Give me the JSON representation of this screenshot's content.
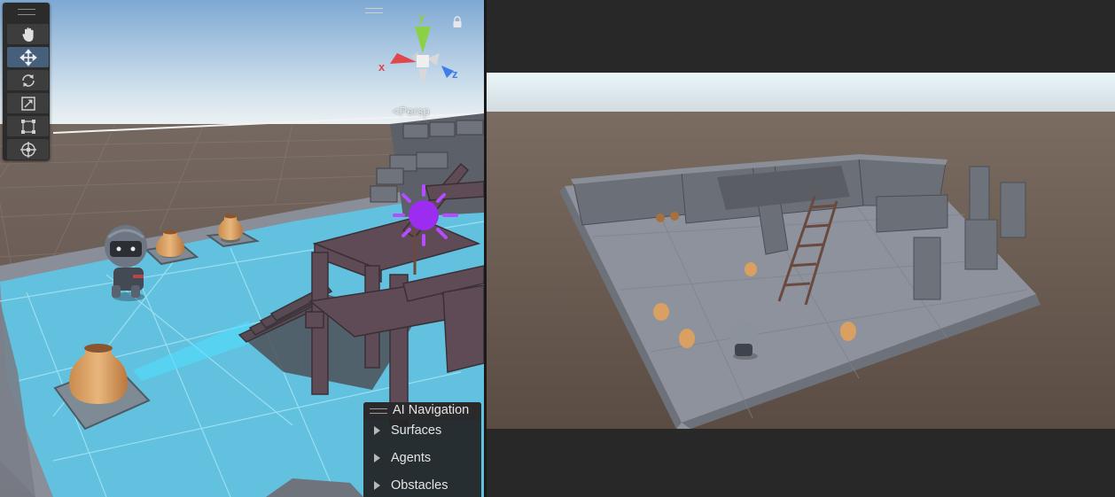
{
  "scene_view": {
    "toolbar": {
      "tools": [
        {
          "name": "hand-tool",
          "icon": "hand-icon",
          "active": false
        },
        {
          "name": "move-tool",
          "icon": "move-icon",
          "active": true
        },
        {
          "name": "rotate-tool",
          "icon": "rotate-icon",
          "active": false
        },
        {
          "name": "scale-tool",
          "icon": "scale-icon",
          "active": false
        },
        {
          "name": "rect-tool",
          "icon": "rect-transform-icon",
          "active": false
        },
        {
          "name": "transform-tool",
          "icon": "transform-icon",
          "active": false
        }
      ]
    },
    "gizmo": {
      "y_label": "y",
      "x_label": "x",
      "z_label": "z",
      "projection_label": "Persp",
      "colors": {
        "x": "#e0474c",
        "y": "#8cd045",
        "z": "#3d7ee6"
      }
    },
    "ai_navigation": {
      "title": "AI Navigation",
      "items": [
        "Surfaces",
        "Agents",
        "Obstacles"
      ]
    }
  },
  "colors": {
    "navmesh": "#5ec6e4",
    "sky_top": "#8cb3d8",
    "ground": "#6f5f55",
    "active_tool": "#46607c",
    "editor_bg": "#282828"
  }
}
